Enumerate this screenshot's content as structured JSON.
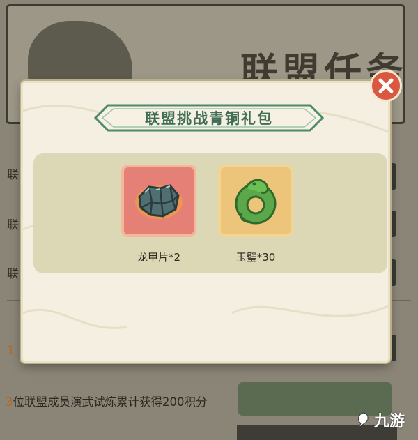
{
  "background": {
    "title": "联盟任务",
    "left_labels": [
      "联",
      "联",
      "联"
    ],
    "task_prefix_partial": "1",
    "task": {
      "number": "3",
      "text": "位联盟成员演武试炼累计获得200积分"
    }
  },
  "modal": {
    "title": "联盟挑战青铜礼包",
    "items": [
      {
        "label": "龙甲片*2",
        "icon": "dragon-scale-icon"
      },
      {
        "label": "玉璧*30",
        "icon": "jade-dragon-disc-icon"
      }
    ]
  },
  "watermark": {
    "text": "九游"
  },
  "colors": {
    "title_green": "#3f6d55",
    "close_red": "#d9583f",
    "item_red": "#e58077",
    "item_gold": "#ecc57b"
  }
}
